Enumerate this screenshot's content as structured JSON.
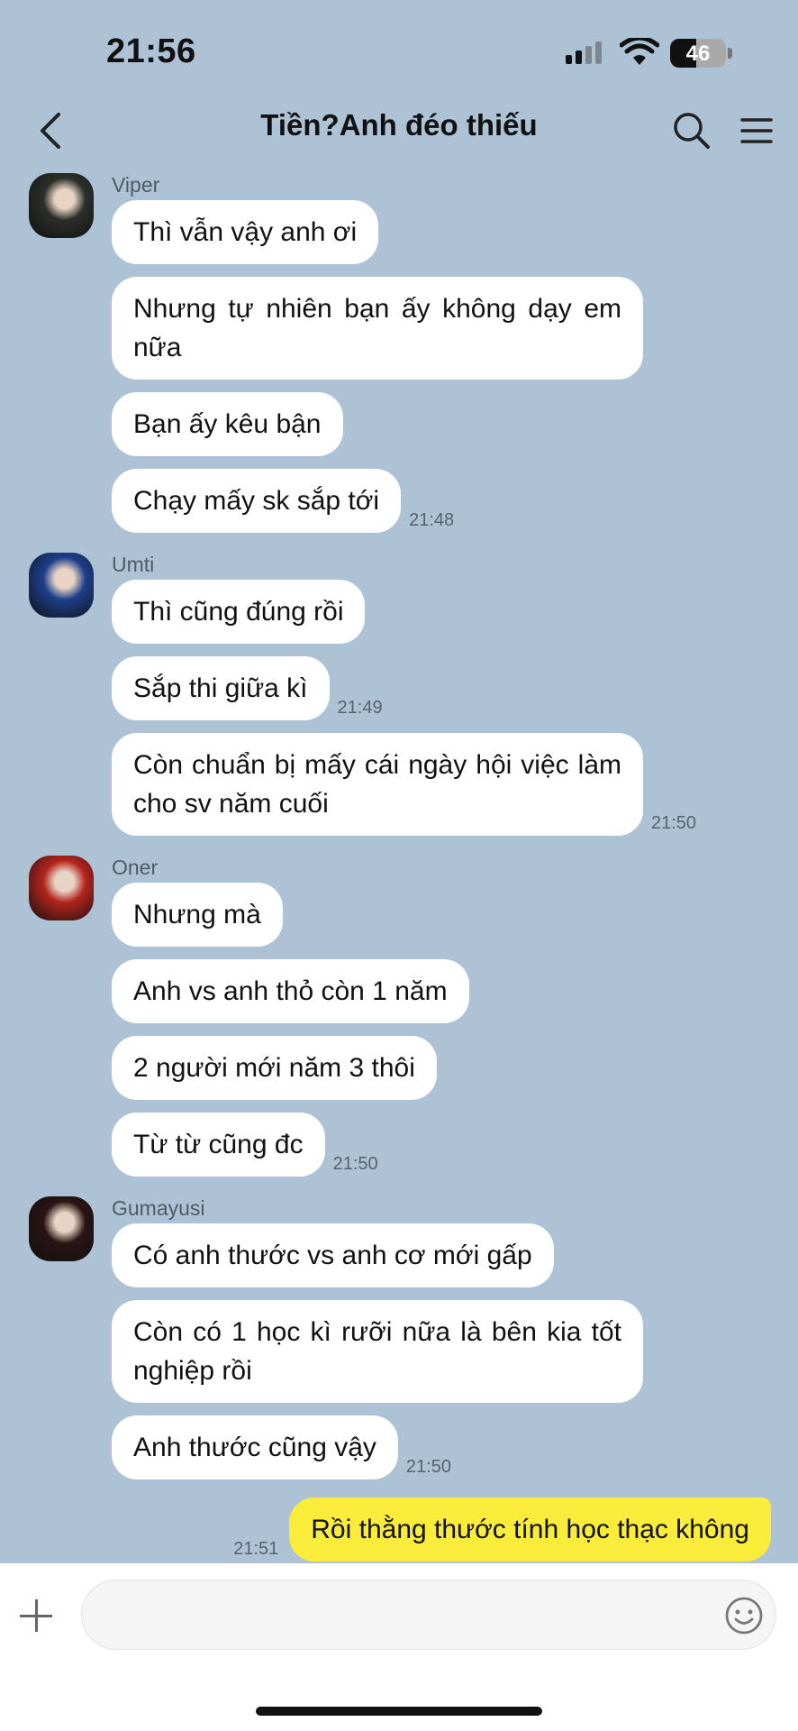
{
  "status_bar": {
    "time": "21:56",
    "battery": "46",
    "battery_level_percent": 46
  },
  "header": {
    "title": "Tiền?Anh đéo thiếu"
  },
  "groups": [
    {
      "sender": "Viper",
      "avatar_color": "#2b2f2a",
      "messages": [
        {
          "text": "Thì vẫn vậy anh ơi",
          "time": ""
        },
        {
          "text": "Nhưng tự nhiên bạn ấy không dạy em nữa",
          "time": ""
        },
        {
          "text": "Bạn ấy kêu bận",
          "time": ""
        },
        {
          "text": "Chạy mấy sk sắp tới",
          "time": "21:48"
        }
      ]
    },
    {
      "sender": "Umti",
      "avatar_color": "#1d3f8a",
      "messages": [
        {
          "text": "Thì cũng đúng rồi",
          "time": ""
        },
        {
          "text": "Sắp thi giữa kì",
          "time": "21:49"
        },
        {
          "text": "Còn chuẩn bị mấy cái ngày hội việc làm cho sv năm cuối",
          "time": "21:50"
        }
      ]
    },
    {
      "sender": "Oner",
      "avatar_color": "#b3241e",
      "messages": [
        {
          "text": "Nhưng mà",
          "time": ""
        },
        {
          "text": "Anh vs anh thỏ còn 1 năm",
          "time": ""
        },
        {
          "text": "2 người mới năm 3 thôi",
          "time": ""
        },
        {
          "text": "Từ từ cũng đc",
          "time": "21:50"
        }
      ]
    },
    {
      "sender": "Gumayusi",
      "avatar_color": "#2a1414",
      "messages": [
        {
          "text": "Có anh thước vs anh cơ mới gấp",
          "time": ""
        },
        {
          "text": "Còn có 1 học kì rưỡi nữa là bên kia tốt nghiệp rồi",
          "time": ""
        },
        {
          "text": "Anh thước cũng vậy",
          "time": "21:50"
        }
      ]
    }
  ],
  "own_message": {
    "text": "Rồi thằng thước tính học thạc không",
    "time": "21:51"
  },
  "colors": {
    "background": "#aec2d6",
    "own_bubble": "#f9ec3b",
    "other_bubble": "#ffffff"
  },
  "input": {
    "value": "",
    "placeholder": ""
  }
}
